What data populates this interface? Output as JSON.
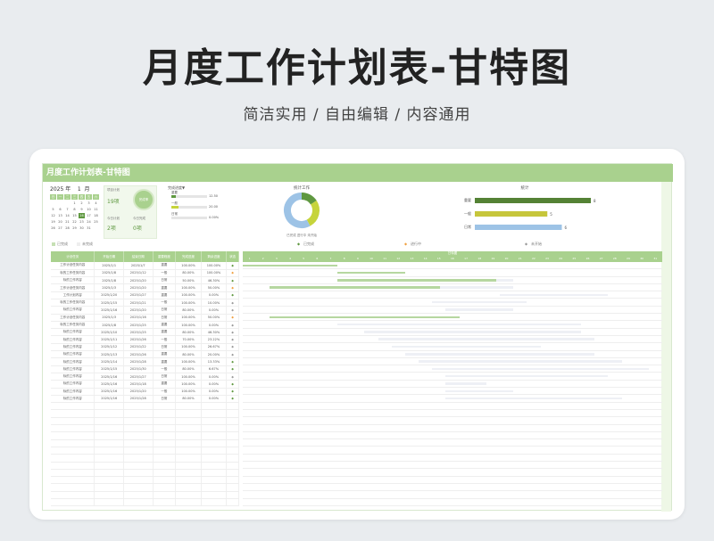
{
  "page": {
    "title": "月度工作计划表-甘特图",
    "subtitle": "简洁实用 / 自由编辑 / 内容通用"
  },
  "sheet": {
    "header_title": "月度工作计划表-甘特图",
    "calendar": {
      "year": "2025",
      "year_unit": "年",
      "month": "1",
      "month_unit": "月",
      "weekdays": [
        "日",
        "一",
        "二",
        "三",
        "四",
        "五",
        "六"
      ],
      "days": [
        "",
        "",
        "",
        "1",
        "2",
        "3",
        "4",
        "5",
        "6",
        "7",
        "8",
        "9",
        "10",
        "11",
        "12",
        "13",
        "14",
        "15",
        "16",
        "17",
        "18",
        "19",
        "20",
        "21",
        "22",
        "23",
        "24",
        "25",
        "26",
        "27",
        "28",
        "29",
        "30",
        "31",
        "",
        ""
      ],
      "today": "16"
    },
    "stats": {
      "plan_count_label": "项目计划",
      "plan_count_value": "19项",
      "today_plan_label": "今日计划",
      "today_plan_value": "2项",
      "today_done_label": "今日完成",
      "today_done_value": "0项",
      "ring_label": "完成率"
    },
    "progress": {
      "title": "完成进度▼",
      "rows": [
        {
          "name": "重要",
          "value": "12.50",
          "pct": 0.125,
          "color": "#5f9840"
        },
        {
          "name": "一般",
          "value": "20.00",
          "pct": 0.2,
          "color": "#c6d43b"
        },
        {
          "name": "日常",
          "value": "0.00%",
          "pct": 0,
          "color": "#9dc3e6"
        }
      ]
    },
    "donut": {
      "title": "统计工作",
      "legend": [
        "已完成",
        "进行中",
        "未开始"
      ],
      "slices": [
        {
          "value": 3,
          "color": "#5f9840"
        },
        {
          "value": 5,
          "color": "#c6d43b"
        },
        {
          "value": 11,
          "color": "#9dc3e6"
        }
      ]
    },
    "hbar": {
      "title": "统计",
      "rows": [
        {
          "label": "重要",
          "value": 8,
          "color": "#548235"
        },
        {
          "label": "一般",
          "value": 5,
          "color": "#c6c63b"
        },
        {
          "label": "日常",
          "value": 6,
          "color": "#9dc3e6"
        }
      ],
      "max": 8
    },
    "legend_row": [
      "已完成",
      "未完成",
      "◆",
      "已完成",
      "◆",
      "进行中",
      "◆",
      "未开始"
    ],
    "table": {
      "headers": [
        "计划任务",
        "开始日期",
        "结束日期",
        "重要程度",
        "完成进度",
        "剩余进度",
        "状态"
      ],
      "rows": [
        [
          "工作计划任务内容",
          "2025/1/1",
          "2025/1/7",
          "重要",
          "100.00%",
          "100.00%",
          "◆"
        ],
        [
          "标的工作任务内容",
          "2025/1/8",
          "2025/1/12",
          "一般",
          "80.00%",
          "100.00%",
          "◆"
        ],
        [
          "标的工作内容",
          "2025/1/8",
          "2025/1/20",
          "日常",
          "50.00%",
          "46.30%",
          "◆"
        ],
        [
          "工作计划任务内容",
          "2025/1/3",
          "2025/1/20",
          "重要",
          "100.00%",
          "50.00%",
          "◆"
        ],
        [
          "工作计划内容",
          "2025/1/20",
          "2025/1/27",
          "重要",
          "100.00%",
          "0.00%",
          "◆"
        ],
        [
          "标的工作任务内容",
          "2025/1/15",
          "2025/1/21",
          "一般",
          "100.00%",
          "10.00%",
          "◆"
        ],
        [
          "标的工作内容",
          "2025/1/16",
          "2025/1/20",
          "日常",
          "80.00%",
          "0.00%",
          "◆"
        ],
        [
          "工作计划任务内容",
          "2025/1/3",
          "2025/1/16",
          "日常",
          "100.00%",
          "50.00%",
          "◆"
        ],
        [
          "标的工作任务内容",
          "2025/1/8",
          "2025/1/25",
          "重要",
          "100.00%",
          "0.00%",
          "◆"
        ],
        [
          "标的工作内容",
          "2025/1/10",
          "2025/1/25",
          "重要",
          "80.00%",
          "46.30%",
          "◆"
        ],
        [
          "标的工作内容",
          "2025/1/11",
          "2025/1/26",
          "一般",
          "70.00%",
          "23.22%",
          "◆"
        ],
        [
          "标的工作内容",
          "2025/1/12",
          "2025/1/22",
          "日常",
          "100.00%",
          "26.67%",
          "◆"
        ],
        [
          "标的工作内容",
          "2025/1/13",
          "2025/1/26",
          "重要",
          "80.00%",
          "20.00%",
          "◆"
        ],
        [
          "标的工作内容",
          "2025/1/14",
          "2025/1/28",
          "重要",
          "100.00%",
          "13.33%",
          "◆"
        ],
        [
          "标的工作内容",
          "2025/1/15",
          "2025/1/30",
          "一般",
          "80.00%",
          "6.67%",
          "◆"
        ],
        [
          "标的工作内容",
          "2025/1/16",
          "2025/1/27",
          "日常",
          "100.00%",
          "0.00%",
          "◆"
        ],
        [
          "标的工作内容",
          "2025/1/16",
          "2025/1/18",
          "重要",
          "100.00%",
          "0.00%",
          "◆"
        ],
        [
          "标的工作内容",
          "2025/1/16",
          "2025/1/20",
          "一般",
          "100.00%",
          "0.00%",
          "◆"
        ],
        [
          "标的工作内容",
          "2025/1/16",
          "2025/1/28",
          "日常",
          "80.00%",
          "0.00%",
          "◆"
        ]
      ],
      "empty_rows": 14
    },
    "gantt": {
      "title": "甘特图",
      "days": [
        "1",
        "2",
        "3",
        "4",
        "5",
        "6",
        "7",
        "8",
        "9",
        "10",
        "11",
        "12",
        "13",
        "14",
        "15",
        "16",
        "17",
        "18",
        "19",
        "20",
        "21",
        "22",
        "23",
        "24",
        "25",
        "26",
        "27",
        "28",
        "29",
        "30",
        "31"
      ],
      "bars": [
        {
          "start": 1,
          "end": 7,
          "done": 1.0
        },
        {
          "start": 8,
          "end": 12,
          "done": 1.0
        },
        {
          "start": 8,
          "end": 20,
          "done": 0.9
        },
        {
          "start": 3,
          "end": 20,
          "done": 0.7
        },
        {
          "start": 20,
          "end": 27,
          "done": 0
        },
        {
          "start": 15,
          "end": 21,
          "done": 0
        },
        {
          "start": 16,
          "end": 20,
          "done": 0
        },
        {
          "start": 3,
          "end": 16,
          "done": 1.0
        },
        {
          "start": 8,
          "end": 25,
          "done": 0
        },
        {
          "start": 10,
          "end": 25,
          "done": 0
        },
        {
          "start": 11,
          "end": 26,
          "done": 0
        },
        {
          "start": 12,
          "end": 22,
          "done": 0
        },
        {
          "start": 13,
          "end": 26,
          "done": 0
        },
        {
          "start": 14,
          "end": 28,
          "done": 0
        },
        {
          "start": 15,
          "end": 30,
          "done": 0
        },
        {
          "start": 16,
          "end": 27,
          "done": 0
        },
        {
          "start": 16,
          "end": 18,
          "done": 0
        },
        {
          "start": 16,
          "end": 20,
          "done": 0
        },
        {
          "start": 16,
          "end": 28,
          "done": 0
        }
      ]
    }
  },
  "colors": {
    "accent": "#a9d18e",
    "accent_dark": "#5f9840",
    "done_bar": "#b6d7a0",
    "todo_bar": "#eef0f5"
  }
}
